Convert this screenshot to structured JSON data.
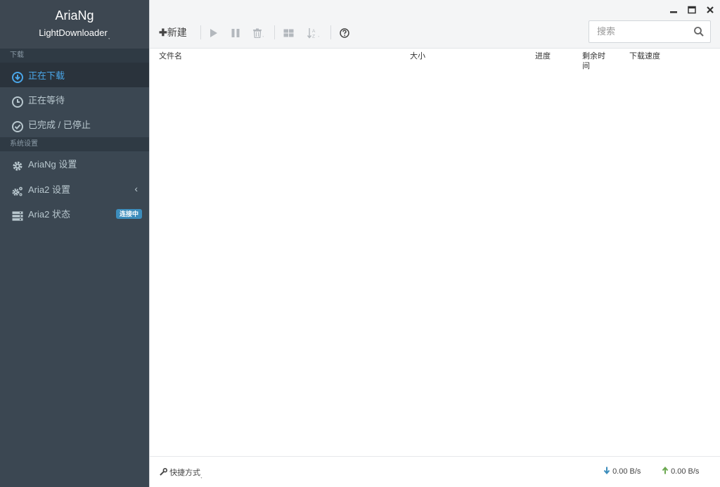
{
  "brand": {
    "title": "AriaNg",
    "subtitle": "LightDownloader",
    "caret": "˯"
  },
  "sidebar": {
    "section_download": "下载",
    "section_settings": "系统设置",
    "items": [
      {
        "label": "正在下载",
        "icon": "download-circle-icon",
        "active": true
      },
      {
        "label": "正在等待",
        "icon": "clock-icon"
      },
      {
        "label": "已完成 / 已停止",
        "icon": "check-circle-icon"
      },
      {
        "label": "AriaNg 设置",
        "icon": "gear-icon"
      },
      {
        "label": "Aria2 设置",
        "icon": "gears-icon",
        "chevron": "‹"
      },
      {
        "label": "Aria2 状态",
        "icon": "server-icon",
        "badge": "连接中"
      }
    ]
  },
  "toolbar": {
    "new_label": "新建",
    "search_placeholder": "搜索"
  },
  "table": {
    "columns": [
      "文件名",
      "大小",
      "进度",
      "剩余时\n间",
      "下载速度"
    ]
  },
  "footer": {
    "shortcut_label": "快捷方式",
    "download_speed": "0.00 B/s",
    "upload_speed": "0.00 B/s"
  },
  "colors": {
    "sidebar_bg": "#3b4752",
    "active_text": "#4aa6e8",
    "badge_bg": "#3c8dbc",
    "down_arrow": "#3c8dbc",
    "up_arrow": "#6aa84f"
  }
}
